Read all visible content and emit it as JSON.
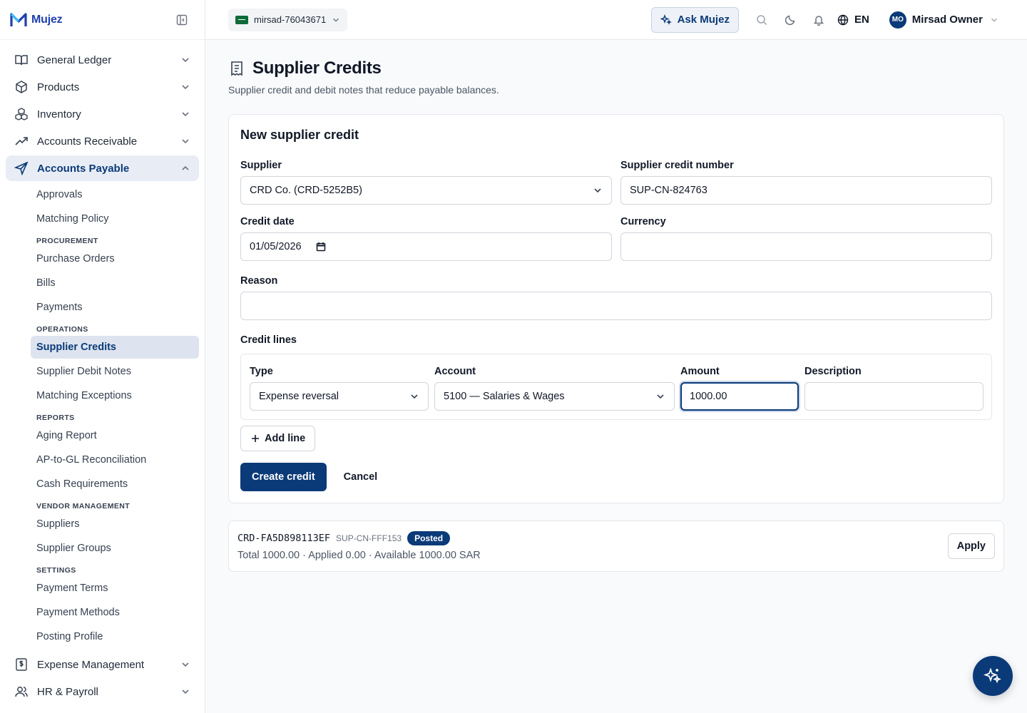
{
  "brand": {
    "name": "Mujez"
  },
  "sidebar": {
    "top_items": [
      {
        "label": "General Ledger",
        "icon": "book-open-icon"
      },
      {
        "label": "Products",
        "icon": "box-icon"
      },
      {
        "label": "Inventory",
        "icon": "boxes-icon"
      },
      {
        "label": "Accounts Receivable",
        "icon": "trending-up-icon"
      }
    ],
    "active_section": {
      "label": "Accounts Payable",
      "icon": "send-icon"
    },
    "sub": {
      "approvals": "Approvals",
      "matching_policy": "Matching Policy",
      "procurement_heading": "PROCUREMENT",
      "purchase_orders": "Purchase Orders",
      "bills": "Bills",
      "payments": "Payments",
      "operations_heading": "OPERATIONS",
      "supplier_credits": "Supplier Credits",
      "supplier_debit_notes": "Supplier Debit Notes",
      "matching_exceptions": "Matching Exceptions",
      "reports_heading": "REPORTS",
      "aging_report": "Aging Report",
      "ap_gl_recon": "AP-to-GL Reconciliation",
      "cash_requirements": "Cash Requirements",
      "vendor_heading": "VENDOR MANAGEMENT",
      "suppliers": "Suppliers",
      "supplier_groups": "Supplier Groups",
      "settings_heading": "SETTINGS",
      "payment_terms": "Payment Terms",
      "payment_methods": "Payment Methods",
      "posting_profile": "Posting Profile"
    },
    "bottom_items": [
      {
        "label": "Expense Management",
        "icon": "receipt-dollar-icon"
      },
      {
        "label": "HR & Payroll",
        "icon": "users-icon"
      }
    ]
  },
  "topbar": {
    "company": "mirsad-76043671",
    "ask_label": "Ask Mujez",
    "language": "EN",
    "user_initials": "MO",
    "user_name": "Mirsad Owner"
  },
  "page": {
    "title": "Supplier Credits",
    "subtitle": "Supplier credit and debit notes that reduce payable balances."
  },
  "form": {
    "title": "New supplier credit",
    "supplier_label": "Supplier",
    "supplier_value": "CRD Co. (CRD-5252B5)",
    "credit_number_label": "Supplier credit number",
    "credit_number_value": "SUP-CN-824763",
    "credit_date_label": "Credit date",
    "credit_date_value": "01/05/2026",
    "currency_label": "Currency",
    "currency_value": "",
    "reason_label": "Reason",
    "reason_value": "",
    "lines_label": "Credit lines",
    "lines_headers": {
      "type": "Type",
      "account": "Account",
      "amount": "Amount",
      "description": "Description"
    },
    "line": {
      "type": "Expense reversal",
      "account": "5100 — Salaries & Wages",
      "amount": "1000.00",
      "description": ""
    },
    "add_line": "Add line",
    "create": "Create credit",
    "cancel": "Cancel"
  },
  "credits": [
    {
      "id": "CRD-FA5D898113EF",
      "ref": "SUP-CN-FFF153",
      "status": "Posted",
      "summary": "Total 1000.00 · Applied 0.00 · Available 1000.00 SAR",
      "apply": "Apply"
    }
  ],
  "colors": {
    "primary": "#0b3a78",
    "accent_logo": "#1e40af",
    "active_bg": "#e8edf5"
  }
}
